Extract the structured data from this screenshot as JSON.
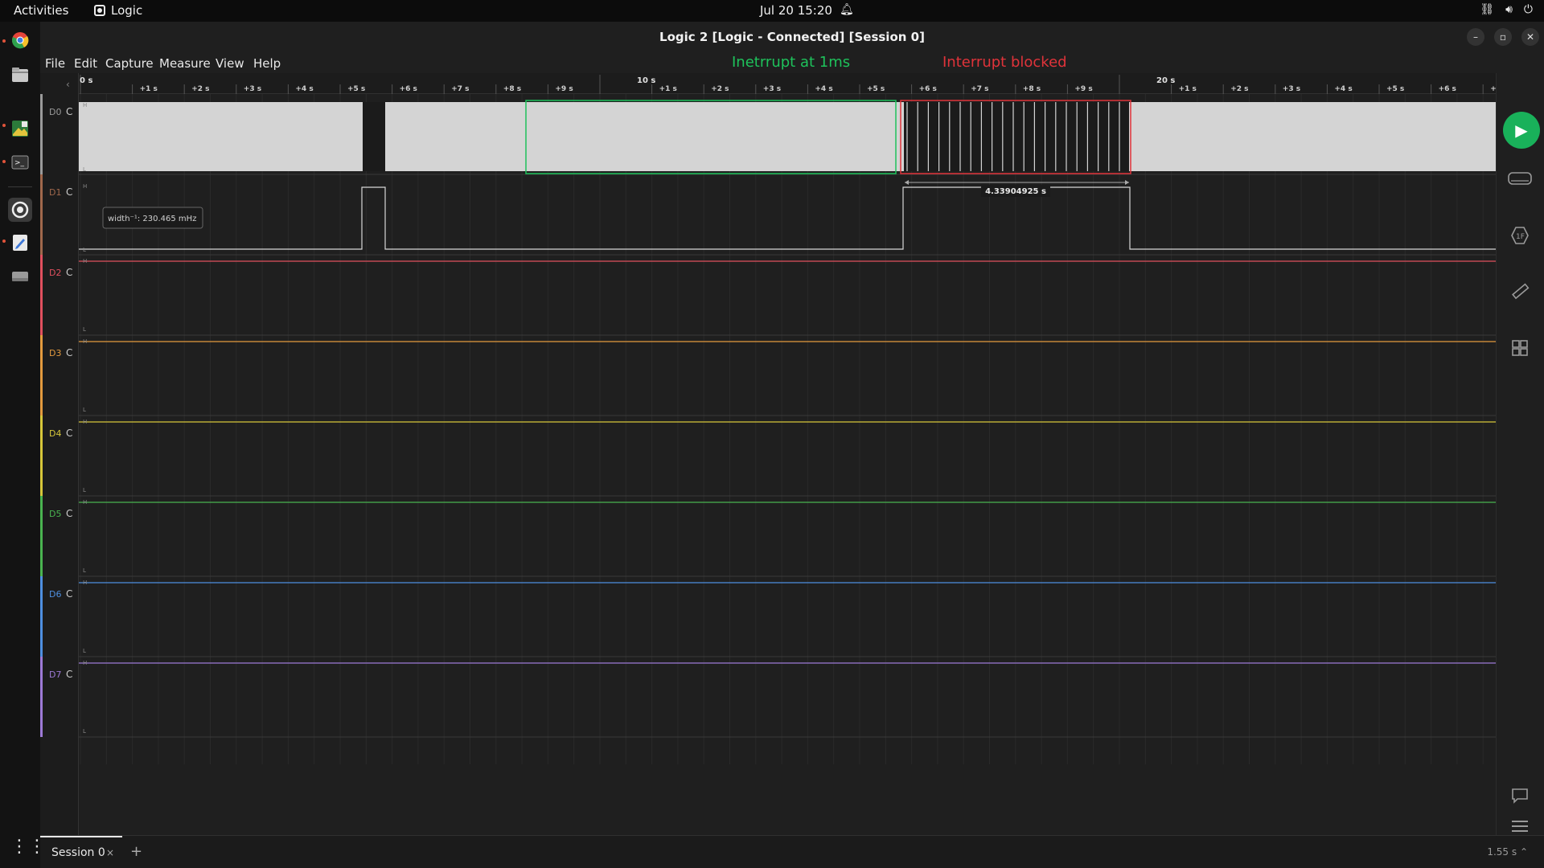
{
  "system_bar": {
    "activities": "Activities",
    "app_name": "Logic",
    "clock": "Jul 20  15:20"
  },
  "window": {
    "title": "Logic 2 [Logic - Connected] [Session 0]"
  },
  "menu": [
    "File",
    "Edit",
    "Capture",
    "Measure",
    "View",
    "Help"
  ],
  "annotations": {
    "green_note": "Inetrrupt at 1ms",
    "red_note": "Interrupt blocked"
  },
  "ruler": {
    "major_labels": [
      "0 s",
      "10 s",
      "20 s"
    ],
    "minor_labels": [
      "+1 s",
      "+2 s",
      "+3 s",
      "+4 s",
      "+5 s",
      "+6 s",
      "+7 s",
      "+8 s",
      "+9 s"
    ]
  },
  "channels": [
    {
      "name": "D0",
      "mode": "C",
      "color": "#9a9a9a"
    },
    {
      "name": "D1",
      "mode": "C",
      "color": "#a0684c"
    },
    {
      "name": "D2",
      "mode": "C",
      "color": "#e0505e"
    },
    {
      "name": "D3",
      "mode": "C",
      "color": "#e39a3e"
    },
    {
      "name": "D4",
      "mode": "C",
      "color": "#d6c63a"
    },
    {
      "name": "D5",
      "mode": "C",
      "color": "#49b350"
    },
    {
      "name": "D6",
      "mode": "C",
      "color": "#4e8fe0"
    },
    {
      "name": "D7",
      "mode": "C",
      "color": "#9d7ad6"
    }
  ],
  "level_labels": {
    "high": "H",
    "low": "L"
  },
  "measurements": {
    "d1_width_tooltip": "width⁻¹: 230.465 mHz",
    "d1_pulse_duration": "4.33904925 s"
  },
  "tabs": {
    "session": "Session 0",
    "close": "×",
    "add": "+",
    "zoom_readout": "1.55 s ⌃"
  },
  "colors": {
    "accent_green": "#19b15a",
    "annotation_green": "#1ec25b",
    "annotation_red": "#e0333a"
  }
}
